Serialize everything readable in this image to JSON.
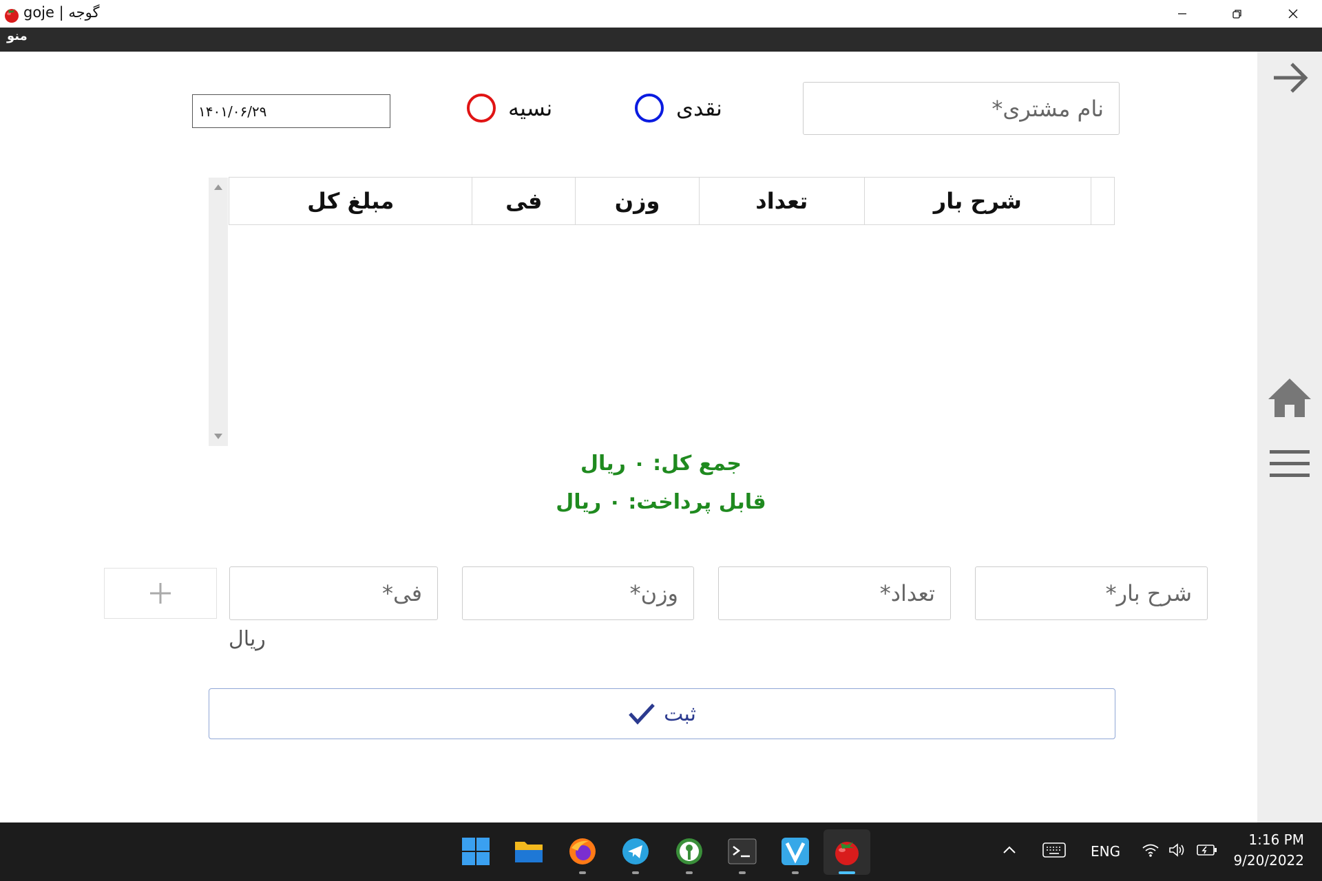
{
  "window": {
    "title": "goje | گوجه"
  },
  "menubar": {
    "menu_label": "منو"
  },
  "form": {
    "customer_placeholder": "نام مشتری*",
    "payment_cash_label": "نقدی",
    "payment_credit_label": "نسیه",
    "date_value": "۱۴۰۱/۰۶/۲۹"
  },
  "table": {
    "columns": [
      "شرح بار",
      "تعداد",
      "وزن",
      "فی",
      "مبلغ کل"
    ],
    "rows": []
  },
  "totals": {
    "sum_text": "جمع کل: ۰ ریال",
    "payable_text": "قابل پرداخت: ۰ ریال"
  },
  "item_entry": {
    "description_placeholder": "شرح بار*",
    "count_placeholder": "تعداد*",
    "weight_placeholder": "وزن*",
    "price_placeholder": "فی*",
    "unit_label": "ریال"
  },
  "actions": {
    "submit_label": "ثبت"
  },
  "taskbar": {
    "apps": [
      "windows-start",
      "file-explorer",
      "firefox",
      "telegram",
      "password-manager",
      "terminal",
      "v-app",
      "goje"
    ],
    "language": "ENG",
    "time": "1:16 PM",
    "date": "9/20/2022"
  },
  "colors": {
    "cash_radio": "#0a1be0",
    "credit_radio": "#e01414",
    "totals_text": "#1f8a1f",
    "submit_text": "#2b3a8f"
  }
}
